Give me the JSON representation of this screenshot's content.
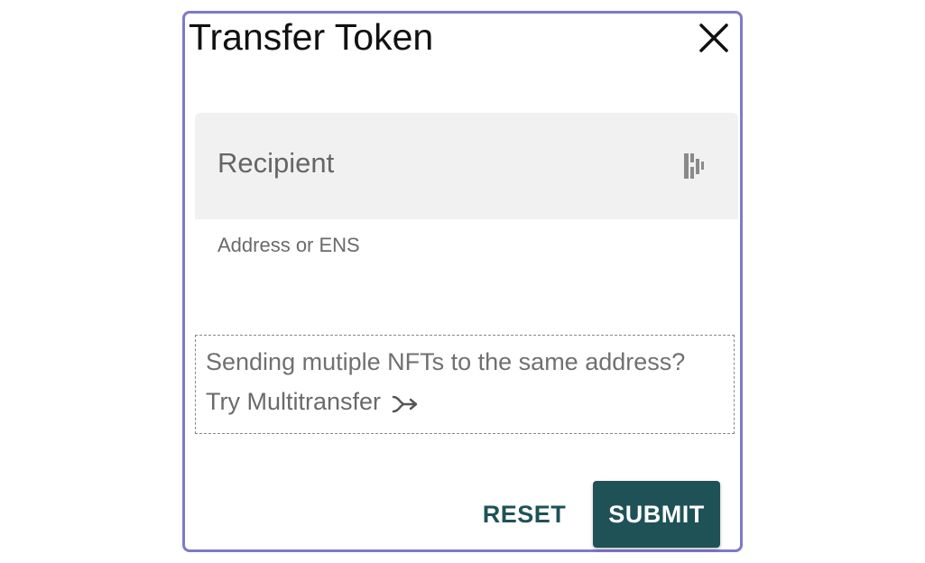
{
  "dialog": {
    "title": "Transfer Token",
    "close_icon": "close-icon"
  },
  "recipient": {
    "placeholder": "Recipient",
    "value": "",
    "helper": "Address or ENS",
    "icon": "ens-icon"
  },
  "multitransfer": {
    "prompt": "Sending mutiple NFTs to the same address?",
    "link_label": "Try Multitransfer",
    "icon": "merge-arrow-icon"
  },
  "actions": {
    "reset_label": "RESET",
    "submit_label": "SUBMIT"
  },
  "colors": {
    "dialog_border": "#7e7ac9",
    "primary": "#1f5257",
    "field_bg": "#f1f1f1"
  }
}
